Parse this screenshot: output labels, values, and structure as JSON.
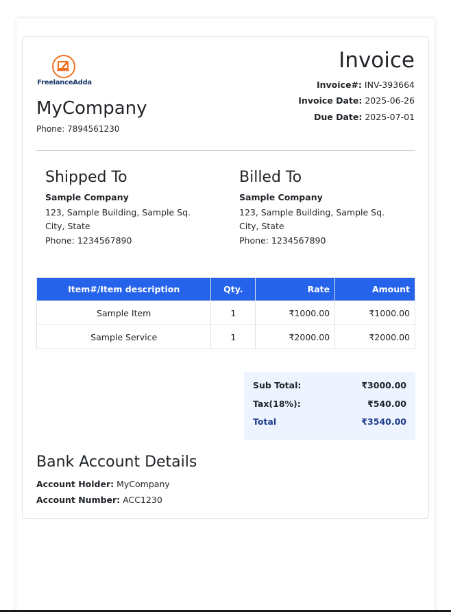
{
  "brand": {
    "logo_text": "FreelanceAdda",
    "logo_icon": "laptop-pencil-icon",
    "accent": "#f26f21"
  },
  "company": {
    "name": "MyCompany",
    "phone_label": "Phone:",
    "phone": "7894561230"
  },
  "invoice": {
    "title": "Invoice",
    "number_label": "Invoice#:",
    "number": "INV-393664",
    "date_label": "Invoice Date:",
    "date": "2025-06-26",
    "due_label": "Due Date:",
    "due": "2025-07-01"
  },
  "shipped": {
    "heading": "Shipped To",
    "name": "Sample Company",
    "address": "123, Sample Building, Sample Sq. City, State",
    "phone_label": "Phone:",
    "phone": "1234567890"
  },
  "billed": {
    "heading": "Billed To",
    "name": "Sample Company",
    "address": "123, Sample Building, Sample Sq. City, State",
    "phone_label": "Phone:",
    "phone": "1234567890"
  },
  "table": {
    "headers": [
      "Item#/Item description",
      "Qty.",
      "Rate",
      "Amount"
    ],
    "header_color": "#2563eb",
    "rows": [
      [
        "Sample Item",
        "1",
        "₹1000.00",
        "₹1000.00"
      ],
      [
        "Sample Service",
        "1",
        "₹2000.00",
        "₹2000.00"
      ]
    ]
  },
  "totals": {
    "subtotal_label": "Sub Total:",
    "subtotal": "₹3000.00",
    "tax_label": "Tax(18%):",
    "tax": "₹540.00",
    "total_label": "Total",
    "total": "₹3540.00"
  },
  "bank": {
    "heading": "Bank Account Details",
    "holder_label": "Account Holder:",
    "holder": "MyCompany",
    "number_label": "Account Number:",
    "number": "ACC1230"
  }
}
